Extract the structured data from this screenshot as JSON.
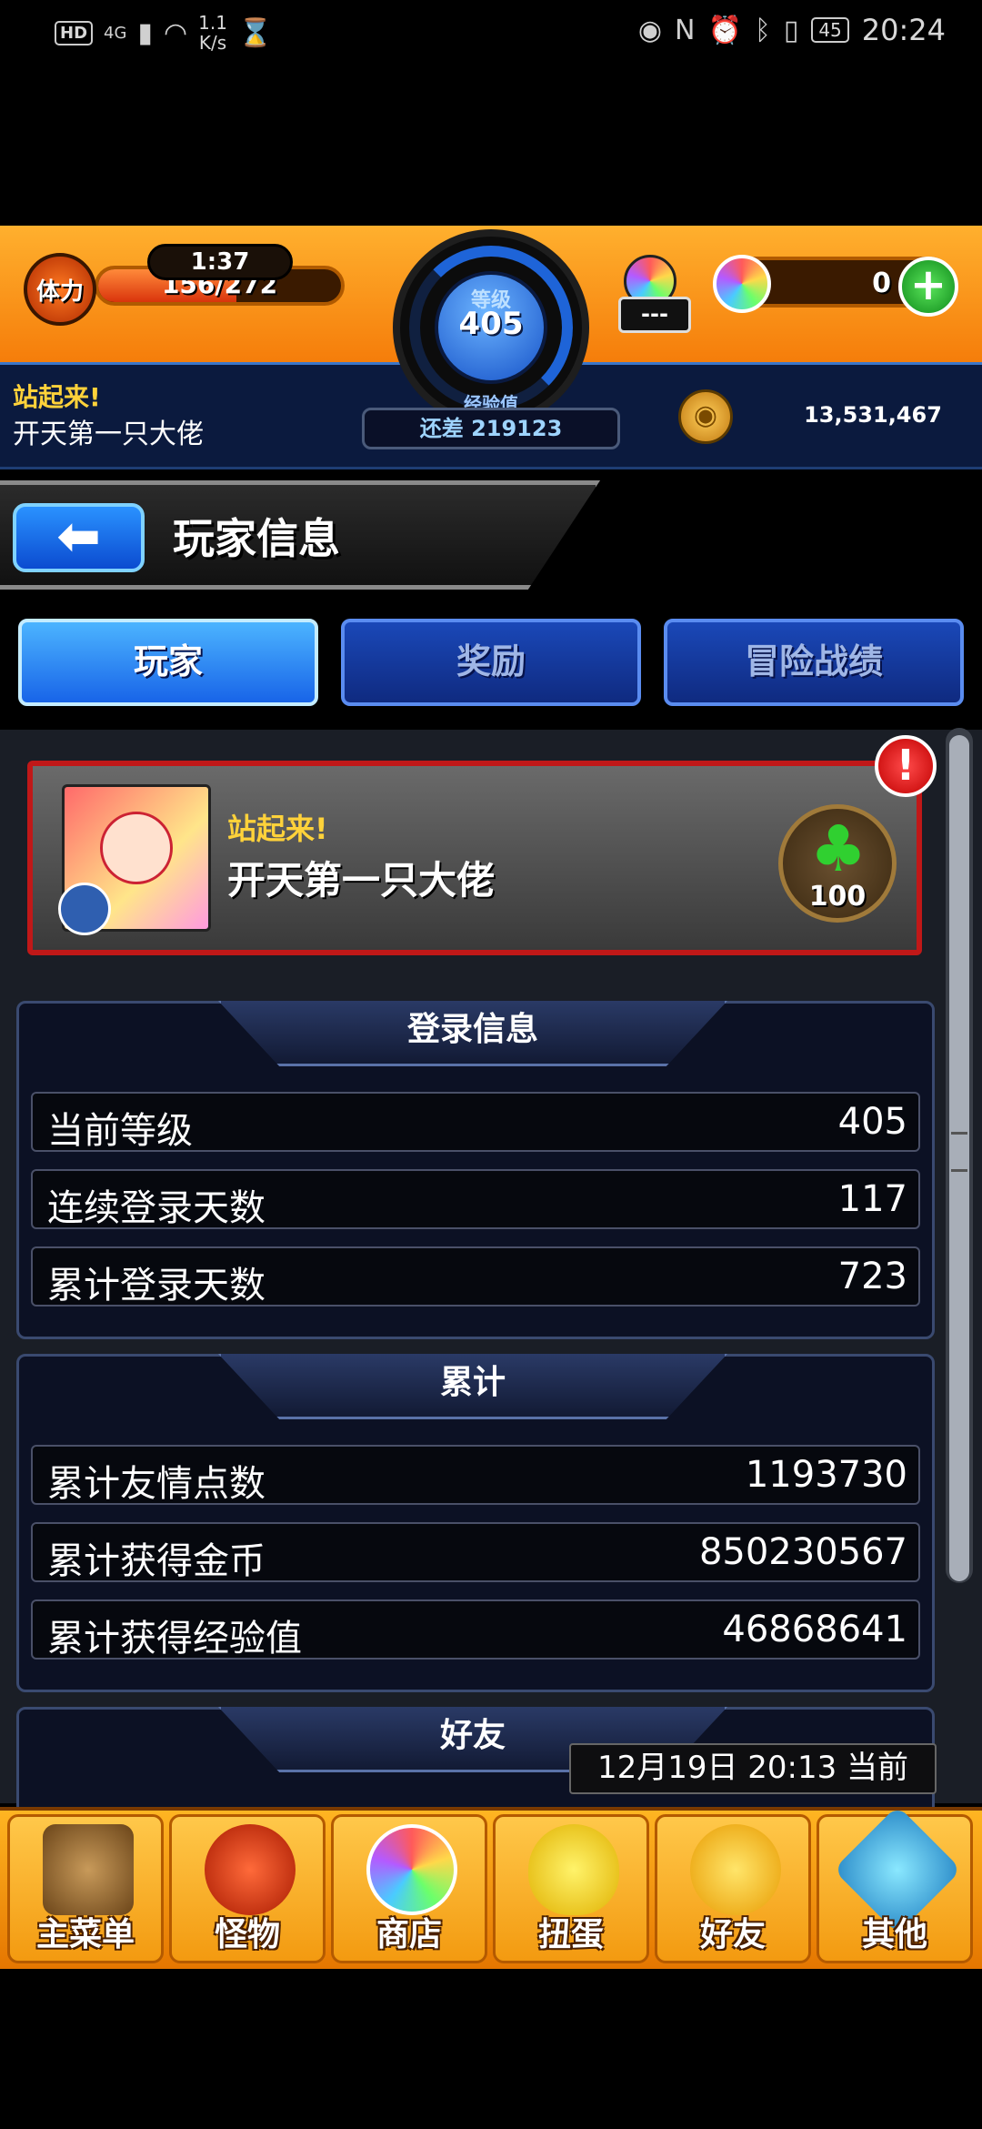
{
  "status_bar": {
    "hd": "HD",
    "network": "4G",
    "speed_value": "1.1",
    "speed_unit": "K/s",
    "battery": "45",
    "time": "20:24"
  },
  "hud": {
    "stamina_label": "体力",
    "stamina_timer": "1:37",
    "stamina_value": "156/272",
    "stamina_fraction": 0.57,
    "level_label": "等级",
    "level": "405",
    "exp_label": "经验值",
    "exp_remaining": "还差 219123",
    "gem_box": "---",
    "orb_count": "0",
    "plus": "+",
    "title": "站起来!",
    "name": "开天第一只大佬",
    "coins": "13,531,467"
  },
  "header": {
    "back_glyph": "⬅",
    "title": "玩家信息"
  },
  "tabs": [
    {
      "label": "玩家",
      "active": true
    },
    {
      "label": "奖励",
      "active": false
    },
    {
      "label": "冒险战绩",
      "active": false
    }
  ],
  "player_card": {
    "title": "站起来!",
    "name": "开天第一只大佬",
    "clover_value": "100",
    "alert": "!"
  },
  "sections": {
    "login": {
      "heading": "登录信息",
      "rows": [
        {
          "label": "当前等级",
          "value": "405"
        },
        {
          "label": "连续登录天数",
          "value": "117"
        },
        {
          "label": "累计登录天数",
          "value": "723"
        }
      ]
    },
    "totals": {
      "heading": "累计",
      "rows": [
        {
          "label": "累计友情点数",
          "value": "1193730"
        },
        {
          "label": "累计获得金币",
          "value": "850230567"
        },
        {
          "label": "累计获得经验值",
          "value": "46868641"
        }
      ]
    },
    "friends": {
      "heading": "好友"
    }
  },
  "timestamp": "12月19日 20:13 当前",
  "bottom_nav": [
    {
      "label": "主菜单",
      "icon": "castle-icon"
    },
    {
      "label": "怪物",
      "icon": "monster-icon"
    },
    {
      "label": "商店",
      "icon": "orb-icon"
    },
    {
      "label": "扭蛋",
      "icon": "egg-icon"
    },
    {
      "label": "好友",
      "icon": "friends-icon"
    },
    {
      "label": "其他",
      "icon": "question-icon"
    }
  ],
  "colors": {
    "accent_orange": "#f57d0a",
    "tab_active": "#1864e8",
    "card_border": "#c01818",
    "gold_text": "#ffd23a"
  }
}
